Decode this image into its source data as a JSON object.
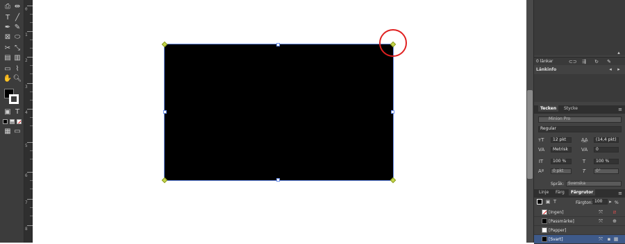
{
  "links_panel": {
    "count_label": "0 länkar",
    "info_title": "Länkinfo"
  },
  "character_panel": {
    "tabs": [
      "Tecken",
      "Stycke"
    ],
    "font_family": "Minion Pro",
    "font_style": "Regular",
    "font_size": "12 pkt",
    "leading": "(14,4 pkt)",
    "kerning": "Metrisk",
    "tracking": "0",
    "vertical_scale": "100 %",
    "horizontal_scale": "100 %",
    "baseline_shift": "0 pkt",
    "skew": "0°",
    "language_label": "Språk:",
    "language": "Svenska"
  },
  "swatches_panel": {
    "tabs": [
      "Linje",
      "Färg",
      "Färgrutor"
    ],
    "tint_label": "Färgton:",
    "tint_value": "100",
    "tint_unit": "%",
    "swatches": [
      {
        "name": "[Ingen]",
        "color": "#ffffff"
      },
      {
        "name": "[Passmärke]",
        "color": "#000000"
      },
      {
        "name": "[Papper]",
        "color": "#ffffff"
      },
      {
        "name": "[Svart]",
        "color": "#000000"
      }
    ]
  },
  "colors": {
    "frame_fill": "#000000",
    "selection": "#6b8ee8",
    "highlight_circle": "#e02020"
  }
}
